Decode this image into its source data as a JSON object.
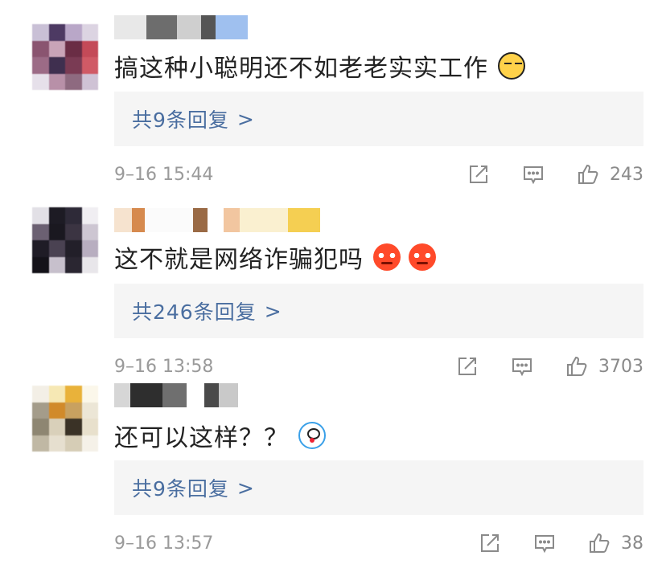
{
  "comments": [
    {
      "text": "搞这种小聪明还不如老老实实工作",
      "emoji": "smirk-emoji",
      "replies_label": "共9条回复",
      "replies_arrow": ">",
      "timestamp": "9–16 15:44",
      "likes": "243"
    },
    {
      "text": "这不就是网络诈骗犯吗",
      "emoji": "angry-emoji",
      "replies_label": "共246条回复",
      "replies_arrow": ">",
      "timestamp": "9–16 13:58",
      "likes": "3703"
    },
    {
      "text": "还可以这样？？",
      "emoji": "doraemon-emoji",
      "replies_label": "共9条回复",
      "replies_arrow": ">",
      "timestamp": "9–16 13:57",
      "likes": "38"
    }
  ],
  "icons": {
    "share": "share-icon",
    "reply": "comment-icon",
    "like": "thumbs-up-icon"
  },
  "colors": {
    "reply_link": "#4a6ea0",
    "meta_text": "#9a9a9a",
    "reply_box_bg": "#f5f5f5"
  }
}
